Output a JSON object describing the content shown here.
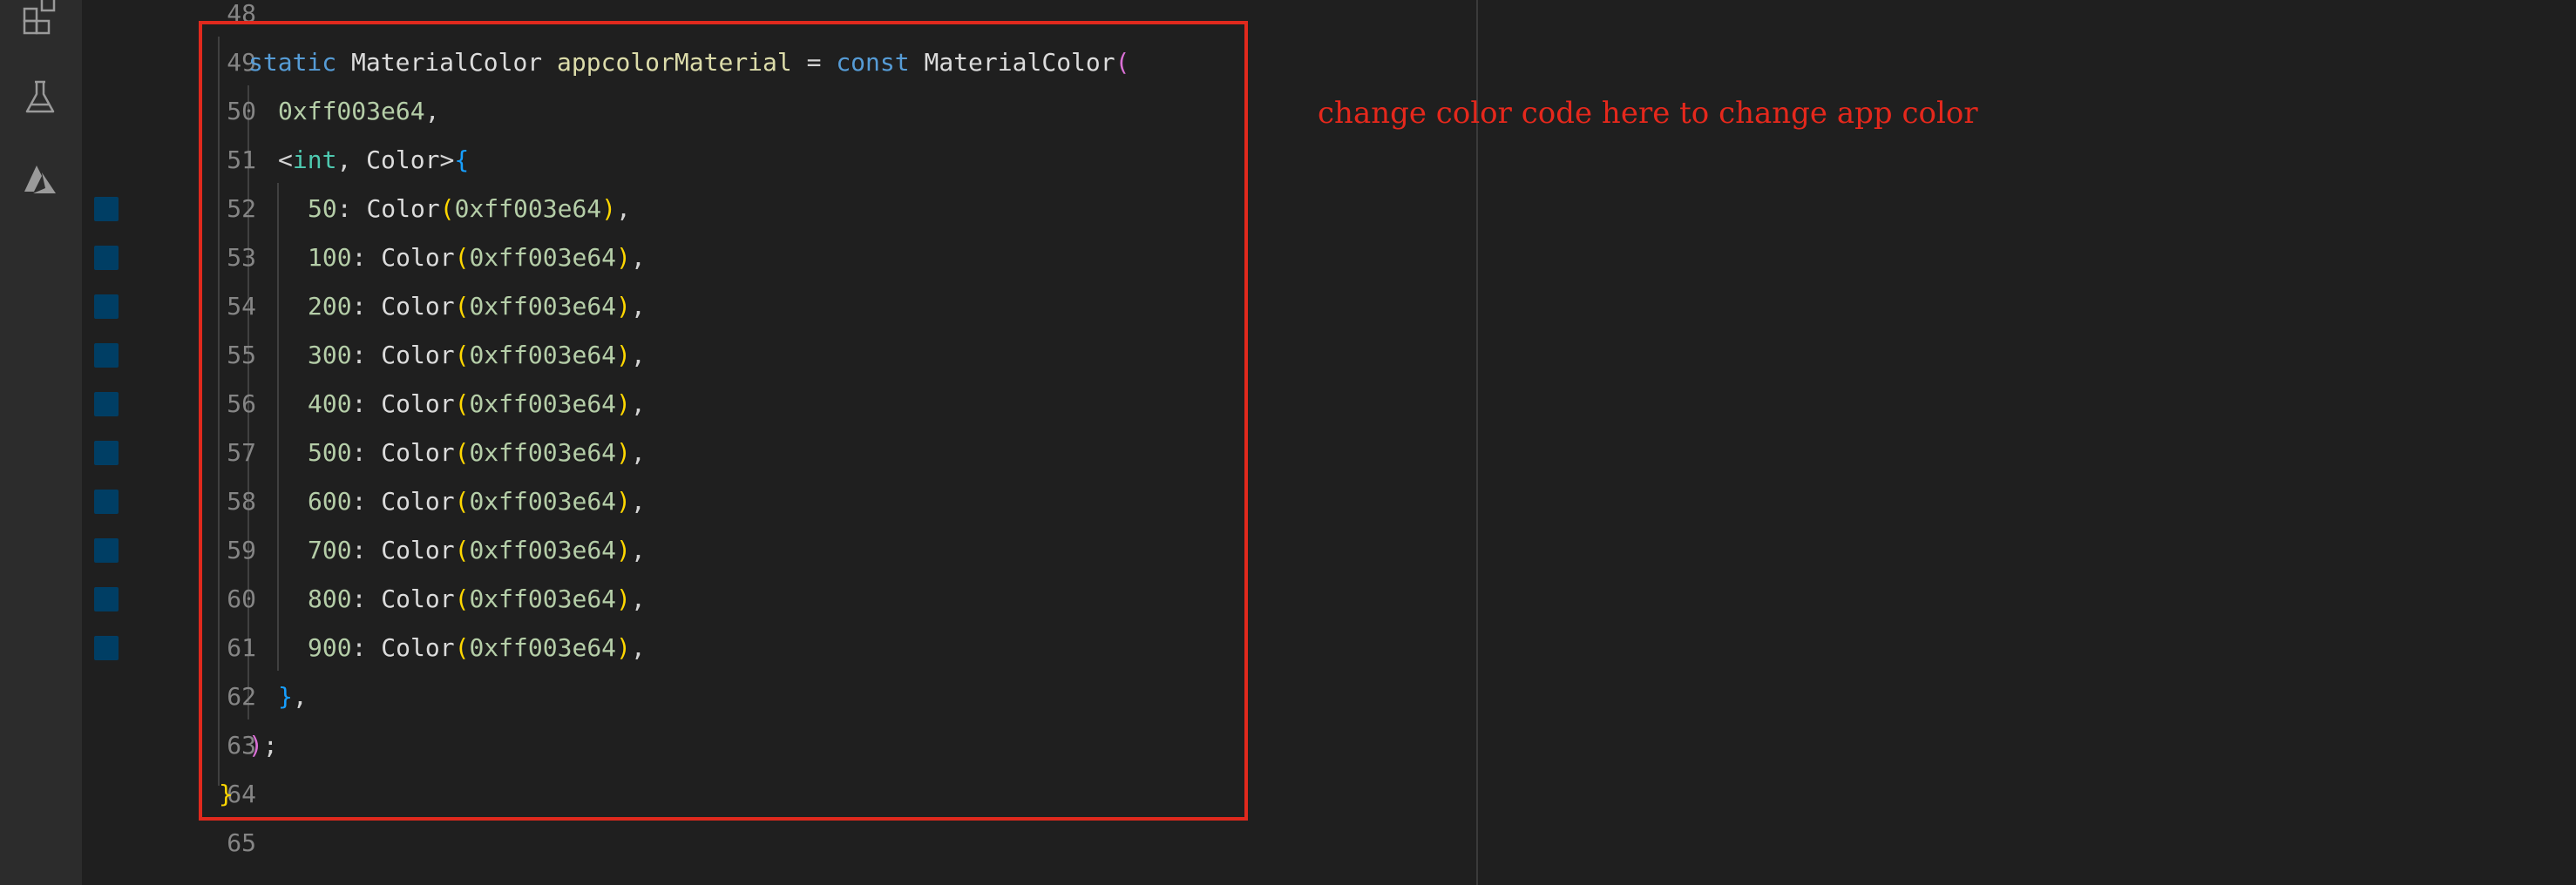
{
  "activity_bar": {
    "icons": [
      "extensions-icon",
      "testing-flask-icon",
      "azure-icon"
    ]
  },
  "annotation": "change color code here to change app color",
  "colors": {
    "annotation": "#e5281c",
    "highlight_box": "#e0291d",
    "color_decorator": "#003e64"
  },
  "lines": [
    {
      "n": "48"
    },
    {
      "n": "49"
    },
    {
      "n": "50"
    },
    {
      "n": "51"
    },
    {
      "n": "52"
    },
    {
      "n": "53"
    },
    {
      "n": "54"
    },
    {
      "n": "55"
    },
    {
      "n": "56"
    },
    {
      "n": "57"
    },
    {
      "n": "58"
    },
    {
      "n": "59"
    },
    {
      "n": "60"
    },
    {
      "n": "61"
    },
    {
      "n": "62"
    },
    {
      "n": "63"
    },
    {
      "n": "64"
    },
    {
      "n": "65"
    }
  ],
  "code": {
    "l49": {
      "static": "static",
      "type": "MaterialColor",
      "name": "appcolorMaterial",
      "eq": " = ",
      "const": "const",
      "ctor": "MaterialColor",
      "open": "("
    },
    "l50": {
      "value": "0xff003e64",
      "comma": ","
    },
    "l51": {
      "lt": "<",
      "int": "int",
      "sep": ", ",
      "color": "Color",
      "gt": ">",
      "brace": "{"
    },
    "entries": [
      {
        "key": "50",
        "colon": ": ",
        "ctor": "Color",
        "open": "(",
        "value": "0xff003e64",
        "close": ")",
        "comma": ","
      },
      {
        "key": "100",
        "colon": ": ",
        "ctor": "Color",
        "open": "(",
        "value": "0xff003e64",
        "close": ")",
        "comma": ","
      },
      {
        "key": "200",
        "colon": ": ",
        "ctor": "Color",
        "open": "(",
        "value": "0xff003e64",
        "close": ")",
        "comma": ","
      },
      {
        "key": "300",
        "colon": ": ",
        "ctor": "Color",
        "open": "(",
        "value": "0xff003e64",
        "close": ")",
        "comma": ","
      },
      {
        "key": "400",
        "colon": ": ",
        "ctor": "Color",
        "open": "(",
        "value": "0xff003e64",
        "close": ")",
        "comma": ","
      },
      {
        "key": "500",
        "colon": ": ",
        "ctor": "Color",
        "open": "(",
        "value": "0xff003e64",
        "close": ")",
        "comma": ","
      },
      {
        "key": "600",
        "colon": ": ",
        "ctor": "Color",
        "open": "(",
        "value": "0xff003e64",
        "close": ")",
        "comma": ","
      },
      {
        "key": "700",
        "colon": ": ",
        "ctor": "Color",
        "open": "(",
        "value": "0xff003e64",
        "close": ")",
        "comma": ","
      },
      {
        "key": "800",
        "colon": ": ",
        "ctor": "Color",
        "open": "(",
        "value": "0xff003e64",
        "close": ")",
        "comma": ","
      },
      {
        "key": "900",
        "colon": ": ",
        "ctor": "Color",
        "open": "(",
        "value": "0xff003e64",
        "close": ")",
        "comma": ","
      }
    ],
    "l62": {
      "brace": "}",
      "comma": ","
    },
    "l63": {
      "paren": ")",
      "semi": ";"
    },
    "l64": {
      "brace": "}"
    }
  }
}
